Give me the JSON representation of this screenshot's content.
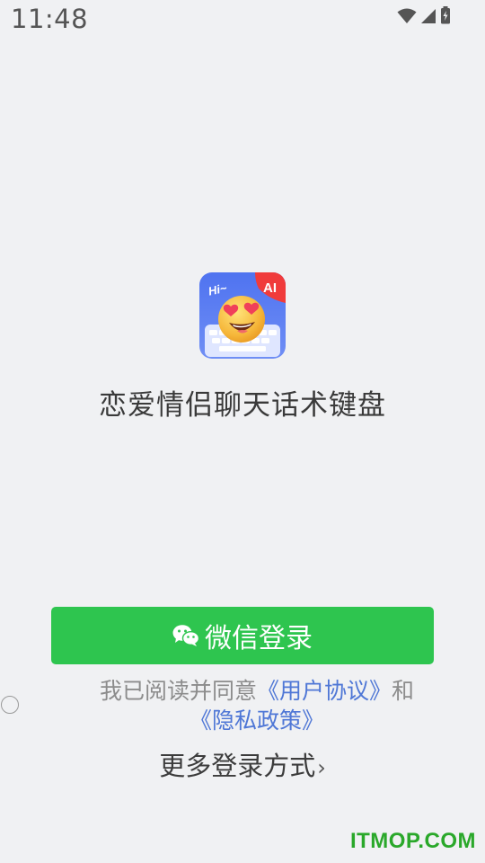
{
  "status_bar": {
    "time": "11:48",
    "icons": [
      "wifi-icon",
      "cellular-signal-icon",
      "battery-icon"
    ]
  },
  "app": {
    "icon_hi_text": "Hi~",
    "icon_ai_badge": "AI",
    "name": "恋爱情侣聊天话术键盘"
  },
  "login": {
    "wechat_button_label": "微信登录",
    "agreement_prefix": "我已阅读并同意",
    "user_agreement_link": "《用户协议》",
    "and_text": "和",
    "privacy_policy_link": "《隐私政策》",
    "more_login_label": "更多登录方式",
    "more_login_chevron": "›"
  },
  "watermark": "ITMOP.COM",
  "colors": {
    "background": "#f0f1f3",
    "wechat_green": "#2ec54f",
    "link_blue": "#4f77d6",
    "muted_text": "#8c8c8c"
  }
}
